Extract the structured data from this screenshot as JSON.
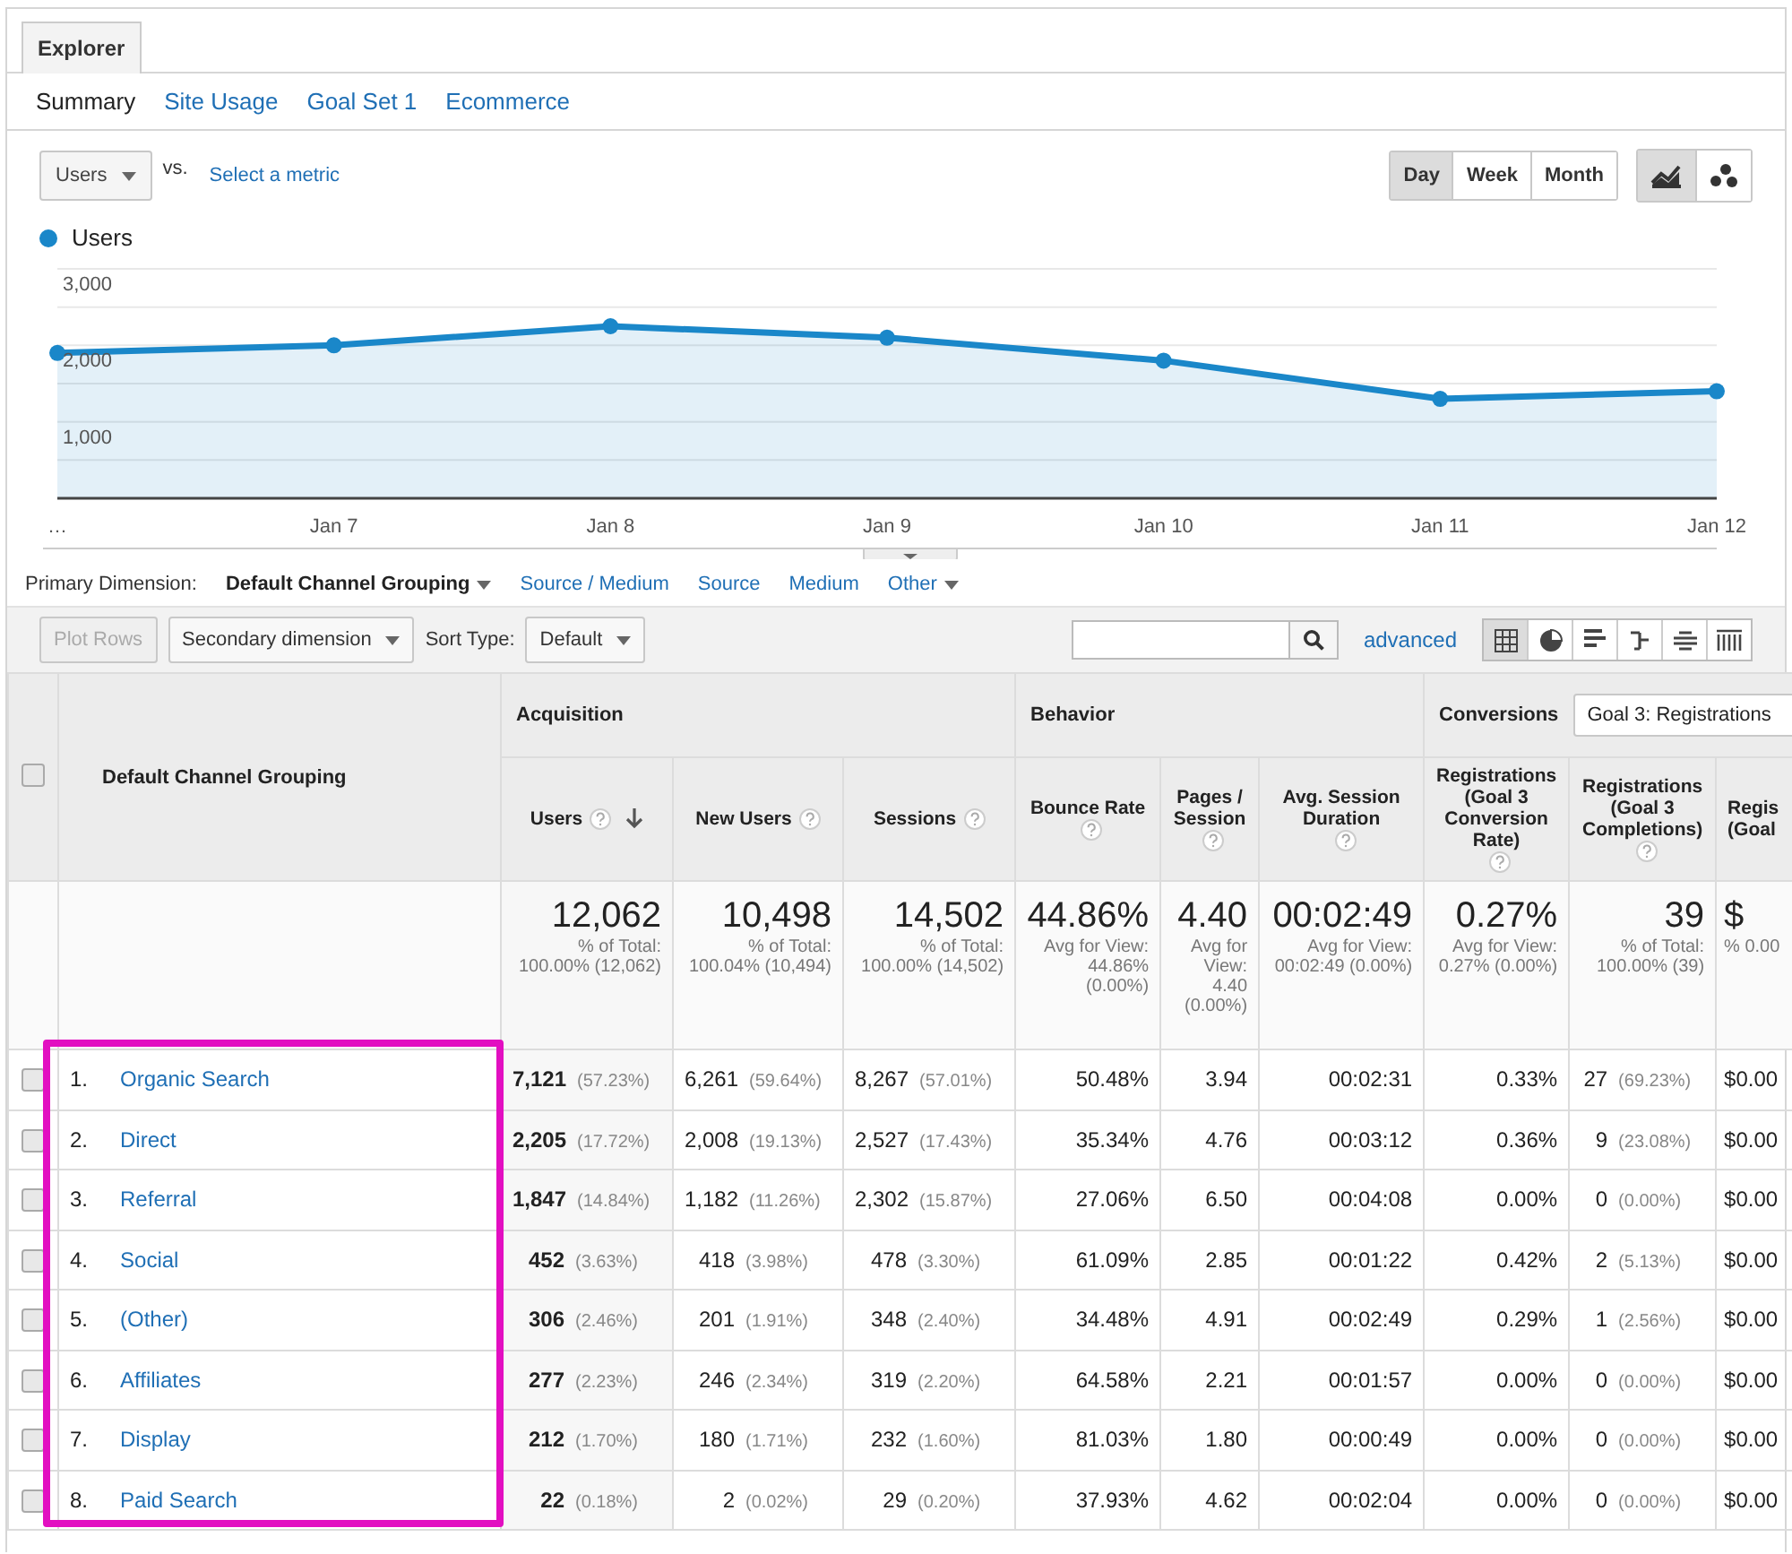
{
  "tab": {
    "label": "Explorer",
    "selected": true
  },
  "subtabs": [
    {
      "label": "Summary",
      "selected": true
    },
    {
      "label": "Site Usage",
      "selected": false
    },
    {
      "label": "Goal Set 1",
      "selected": false
    },
    {
      "label": "Ecommerce",
      "selected": false
    }
  ],
  "metric": {
    "value": "Users",
    "vs": "vs.",
    "select": "Select a metric"
  },
  "periods": [
    {
      "label": "Day",
      "selected": true
    },
    {
      "label": "Week",
      "selected": false
    },
    {
      "label": "Month",
      "selected": false
    }
  ],
  "chart_types": [
    {
      "kind": "line",
      "selected": true
    },
    {
      "kind": "motion",
      "selected": false
    }
  ],
  "chart_data": {
    "type": "area",
    "categories": [
      "…",
      "Jan 7",
      "Jan 8",
      "Jan 9",
      "Jan 10",
      "Jan 11",
      "Jan 12"
    ],
    "ylim": [
      0,
      3000
    ],
    "yticks": [
      {
        "value": 1000,
        "label": "1,000"
      },
      {
        "value": 2000,
        "label": "2,000"
      },
      {
        "value": 3000,
        "label": "3,000"
      }
    ],
    "series": [
      {
        "name": "Users",
        "color": "#1a87c9",
        "values": [
          1900,
          2000,
          2250,
          2100,
          1800,
          1300,
          1400
        ]
      }
    ]
  },
  "dimensions": {
    "label": "Primary Dimension:",
    "items": [
      {
        "label": "Default Channel Grouping",
        "selected": true,
        "dropdown": true
      },
      {
        "label": "Source / Medium",
        "selected": false,
        "dropdown": false
      },
      {
        "label": "Source",
        "selected": false,
        "dropdown": false
      },
      {
        "label": "Medium",
        "selected": false,
        "dropdown": false
      },
      {
        "label": "Other",
        "selected": false,
        "dropdown": true
      }
    ]
  },
  "toolbar": {
    "plot_rows": {
      "label": "Plot Rows",
      "disabled": true
    },
    "secondary": "Secondary dimension",
    "sort_label": "Sort Type:",
    "sort_value": "Default",
    "advanced": "advanced",
    "views": [
      {
        "kind": "table",
        "selected": true
      },
      {
        "kind": "pie",
        "selected": false
      },
      {
        "kind": "bars",
        "selected": false
      },
      {
        "kind": "comparison",
        "selected": false
      },
      {
        "kind": "pivot",
        "selected": false
      },
      {
        "kind": "cloud",
        "selected": false
      }
    ]
  },
  "table": {
    "select_all": {
      "checked": false
    },
    "dimension_header": "Default Channel Grouping",
    "groups": [
      {
        "label": "Acquisition",
        "columns": [
          {
            "label": "Users",
            "help": true,
            "sorted": true
          },
          {
            "label": "New Users",
            "help": true,
            "sorted": false
          },
          {
            "label": "Sessions",
            "help": true,
            "sorted": false
          }
        ]
      },
      {
        "label": "Behavior",
        "columns": [
          {
            "label": "Bounce Rate",
            "help": true,
            "sorted": false
          },
          {
            "label": "Pages / Session",
            "help": true,
            "sorted": false
          },
          {
            "label": "Avg. Session Duration",
            "help": true,
            "sorted": false
          }
        ]
      },
      {
        "label": "Conversions",
        "select": "Goal 3: Registrations",
        "columns": [
          {
            "label": "Registrations (Goal 3 Conversion Rate)",
            "help": true,
            "sorted": false
          },
          {
            "label": "Registrations (Goal 3 Completions)",
            "help": true,
            "sorted": false
          },
          {
            "label": "Regis (Goal",
            "help": false,
            "sorted": false
          }
        ]
      }
    ],
    "totals": [
      {
        "value": "12,062",
        "sub": "% of Total: 100.00% (12,062)"
      },
      {
        "value": "10,498",
        "sub": "% of Total: 100.04% (10,494)"
      },
      {
        "value": "14,502",
        "sub": "% of Total: 100.00% (14,502)"
      },
      {
        "value": "44.86%",
        "sub": "Avg for View: 44.86% (0.00%)"
      },
      {
        "value": "4.40",
        "sub": "Avg for View: 4.40 (0.00%)"
      },
      {
        "value": "00:02:49",
        "sub": "Avg for View: 00:02:49 (0.00%)"
      },
      {
        "value": "0.27%",
        "sub": "Avg for View: 0.27% (0.00%)"
      },
      {
        "value": "39",
        "sub": "% of Total: 100.00% (39)"
      },
      {
        "value": "$",
        "sub": "% 0.00"
      }
    ],
    "rows": [
      {
        "index": "1.",
        "name": "Organic Search",
        "checked": false,
        "cells": [
          {
            "value": "7,121",
            "pct": "(57.23%)"
          },
          {
            "value": "6,261",
            "pct": "(59.64%)"
          },
          {
            "value": "8,267",
            "pct": "(57.01%)"
          },
          {
            "value": "50.48%"
          },
          {
            "value": "3.94"
          },
          {
            "value": "00:02:31"
          },
          {
            "value": "0.33%"
          },
          {
            "value": "27",
            "pct": "(69.23%)"
          },
          {
            "value": "$0.00"
          }
        ]
      },
      {
        "index": "2.",
        "name": "Direct",
        "checked": false,
        "cells": [
          {
            "value": "2,205",
            "pct": "(17.72%)"
          },
          {
            "value": "2,008",
            "pct": "(19.13%)"
          },
          {
            "value": "2,527",
            "pct": "(17.43%)"
          },
          {
            "value": "35.34%"
          },
          {
            "value": "4.76"
          },
          {
            "value": "00:03:12"
          },
          {
            "value": "0.36%"
          },
          {
            "value": "9",
            "pct": "(23.08%)"
          },
          {
            "value": "$0.00"
          }
        ]
      },
      {
        "index": "3.",
        "name": "Referral",
        "checked": false,
        "cells": [
          {
            "value": "1,847",
            "pct": "(14.84%)"
          },
          {
            "value": "1,182",
            "pct": "(11.26%)"
          },
          {
            "value": "2,302",
            "pct": "(15.87%)"
          },
          {
            "value": "27.06%"
          },
          {
            "value": "6.50"
          },
          {
            "value": "00:04:08"
          },
          {
            "value": "0.00%"
          },
          {
            "value": "0",
            "pct": "(0.00%)"
          },
          {
            "value": "$0.00"
          }
        ]
      },
      {
        "index": "4.",
        "name": "Social",
        "checked": false,
        "cells": [
          {
            "value": "452",
            "pct": "(3.63%)"
          },
          {
            "value": "418",
            "pct": "(3.98%)"
          },
          {
            "value": "478",
            "pct": "(3.30%)"
          },
          {
            "value": "61.09%"
          },
          {
            "value": "2.85"
          },
          {
            "value": "00:01:22"
          },
          {
            "value": "0.42%"
          },
          {
            "value": "2",
            "pct": "(5.13%)"
          },
          {
            "value": "$0.00"
          }
        ]
      },
      {
        "index": "5.",
        "name": "(Other)",
        "checked": false,
        "cells": [
          {
            "value": "306",
            "pct": "(2.46%)"
          },
          {
            "value": "201",
            "pct": "(1.91%)"
          },
          {
            "value": "348",
            "pct": "(2.40%)"
          },
          {
            "value": "34.48%"
          },
          {
            "value": "4.91"
          },
          {
            "value": "00:02:49"
          },
          {
            "value": "0.29%"
          },
          {
            "value": "1",
            "pct": "(2.56%)"
          },
          {
            "value": "$0.00"
          }
        ]
      },
      {
        "index": "6.",
        "name": "Affiliates",
        "checked": false,
        "cells": [
          {
            "value": "277",
            "pct": "(2.23%)"
          },
          {
            "value": "246",
            "pct": "(2.34%)"
          },
          {
            "value": "319",
            "pct": "(2.20%)"
          },
          {
            "value": "64.58%"
          },
          {
            "value": "2.21"
          },
          {
            "value": "00:01:57"
          },
          {
            "value": "0.00%"
          },
          {
            "value": "0",
            "pct": "(0.00%)"
          },
          {
            "value": "$0.00"
          }
        ]
      },
      {
        "index": "7.",
        "name": "Display",
        "checked": false,
        "cells": [
          {
            "value": "212",
            "pct": "(1.70%)"
          },
          {
            "value": "180",
            "pct": "(1.71%)"
          },
          {
            "value": "232",
            "pct": "(1.60%)"
          },
          {
            "value": "81.03%"
          },
          {
            "value": "1.80"
          },
          {
            "value": "00:00:49"
          },
          {
            "value": "0.00%"
          },
          {
            "value": "0",
            "pct": "(0.00%)"
          },
          {
            "value": "$0.00"
          }
        ]
      },
      {
        "index": "8.",
        "name": "Paid Search",
        "checked": false,
        "cells": [
          {
            "value": "22",
            "pct": "(0.18%)"
          },
          {
            "value": "2",
            "pct": "(0.02%)"
          },
          {
            "value": "29",
            "pct": "(0.20%)"
          },
          {
            "value": "37.93%"
          },
          {
            "value": "4.62"
          },
          {
            "value": "00:02:04"
          },
          {
            "value": "0.00%"
          },
          {
            "value": "0",
            "pct": "(0.00%)"
          },
          {
            "value": "$0.00"
          }
        ]
      }
    ],
    "highlight": {
      "color": "#e20fc1"
    }
  }
}
